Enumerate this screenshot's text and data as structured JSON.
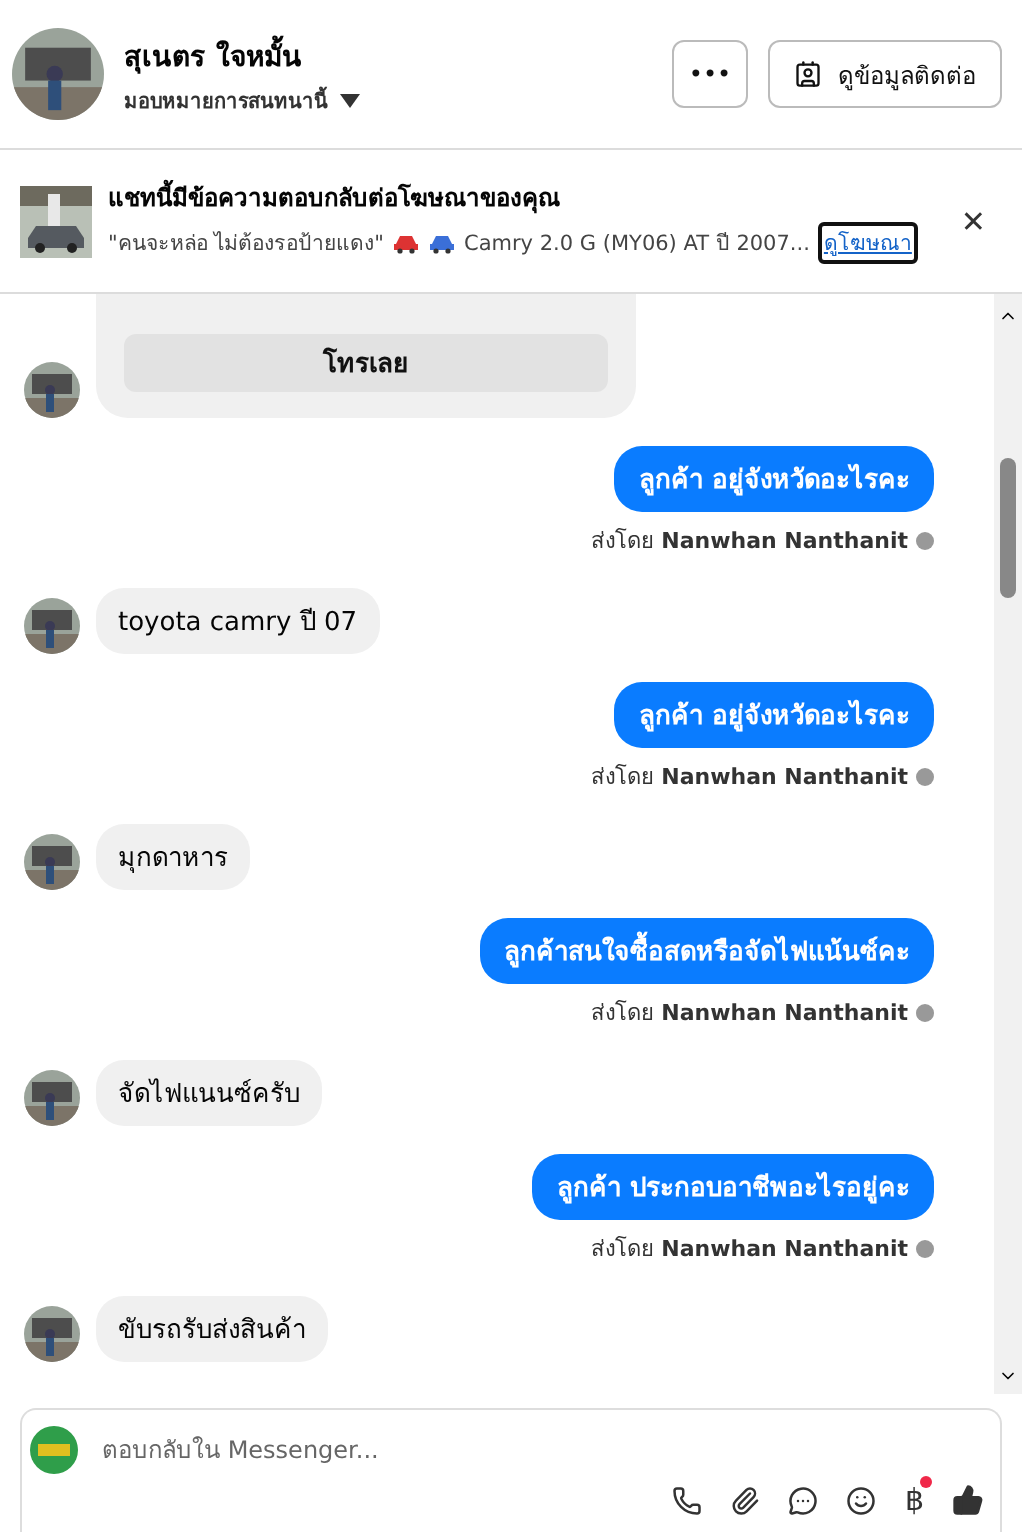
{
  "header": {
    "name": "สุเนตร ใจหมั้น",
    "assign": "มอบหมายการสนทนานี้",
    "more": "•••",
    "contact_button": "ดูข้อมูลติดต่อ"
  },
  "ad_banner": {
    "title": "แชทนี้มีข้อความตอบกลับต่อโฆษณาของคุณ",
    "quote": "\"คนจะหล่อ ไม่ต้องรอป้ายแดง\"",
    "detail": "Camry 2.0 G (MY06) AT ปี 2007...",
    "link": "ดูโฆษณา",
    "close": "✕"
  },
  "messages": [
    {
      "kind": "card",
      "button": "โทรเลย"
    },
    {
      "kind": "outgoing",
      "text": "ลูกค้า อยู่จังหวัดอะไรคะ",
      "sent_label": "ส่งโดย",
      "sender": "Nanwhan Nanthanit"
    },
    {
      "kind": "incoming",
      "text": "toyota camry ปี 07"
    },
    {
      "kind": "outgoing",
      "text": "ลูกค้า อยู่จังหวัดอะไรคะ",
      "sent_label": "ส่งโดย",
      "sender": "Nanwhan Nanthanit"
    },
    {
      "kind": "incoming",
      "text": "มุกดาหาร"
    },
    {
      "kind": "outgoing",
      "text": "ลูกค้าสนใจซื้อสดหรือจัดไฟแน้นซ์คะ",
      "sent_label": "ส่งโดย",
      "sender": "Nanwhan Nanthanit"
    },
    {
      "kind": "incoming",
      "text": "จัดไฟแนนซ์ครับ"
    },
    {
      "kind": "outgoing",
      "text": "ลูกค้า ประกอบอาชีพอะไรอยู่คะ",
      "sent_label": "ส่งโดย",
      "sender": "Nanwhan Nanthanit"
    },
    {
      "kind": "incoming",
      "text": "ขับรถรับส่งสินค้า"
    }
  ],
  "composer": {
    "placeholder": "ตอบกลับใน Messenger...",
    "currency_symbol": "฿"
  }
}
